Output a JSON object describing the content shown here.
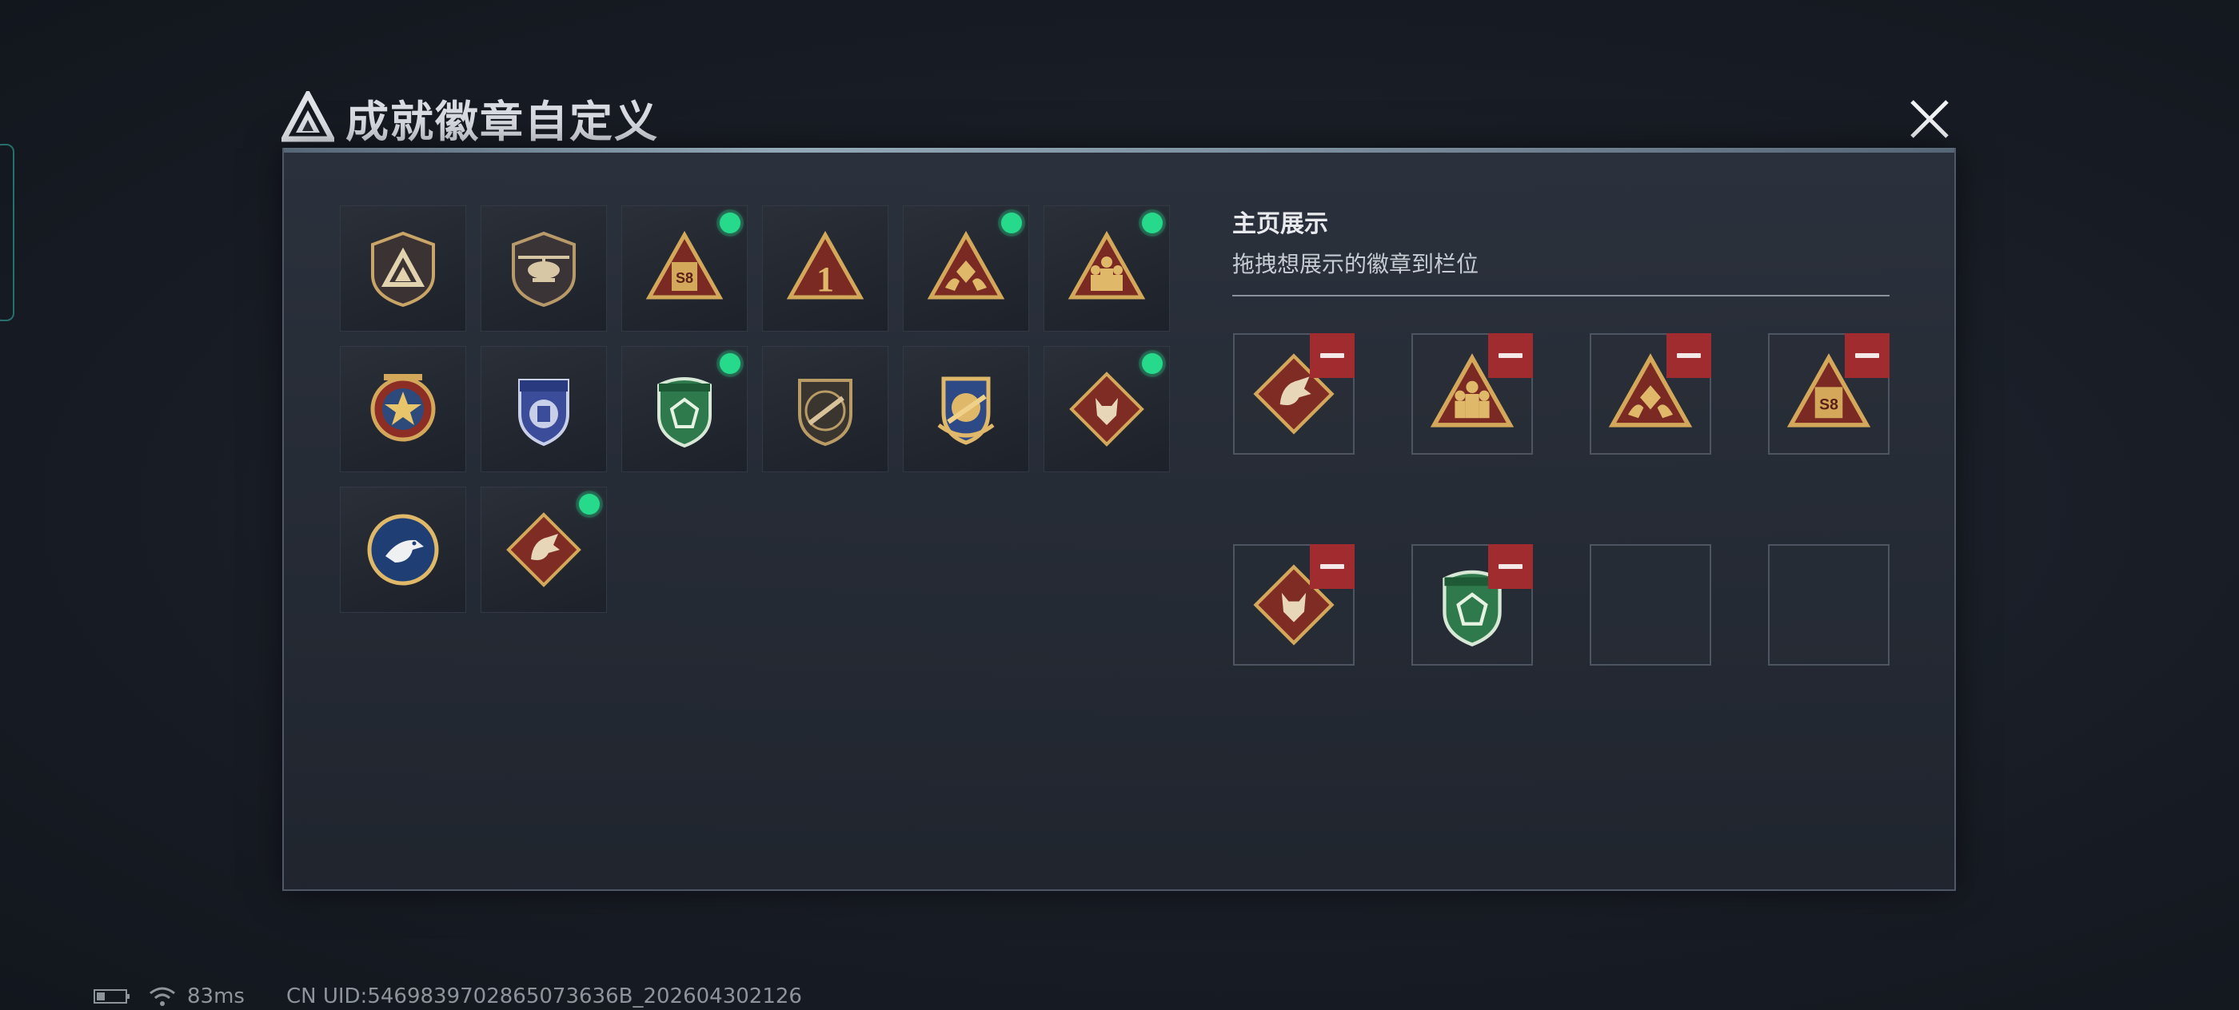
{
  "header": {
    "title": "成就徽章自定义",
    "logo_icon": "triangle-logo-icon",
    "close_icon": "close-icon"
  },
  "badges": [
    {
      "icon": "shield-triangle-badge-icon",
      "selected": false
    },
    {
      "icon": "helicopter-badge-icon",
      "selected": false
    },
    {
      "icon": "s8-triangle-badge-icon",
      "selected": true
    },
    {
      "icon": "number-one-triangle-badge-icon",
      "selected": false
    },
    {
      "icon": "hands-crystal-triangle-badge-icon",
      "selected": true
    },
    {
      "icon": "soldiers-triangle-badge-icon",
      "selected": true
    },
    {
      "icon": "star-medal-badge-icon",
      "selected": false
    },
    {
      "icon": "blue-shield-badge-icon",
      "selected": false
    },
    {
      "icon": "green-crystal-shield-badge-icon",
      "selected": true
    },
    {
      "icon": "rifle-shield-badge-icon",
      "selected": false
    },
    {
      "icon": "blue-gold-crest-badge-icon",
      "selected": false
    },
    {
      "icon": "wolf-diamond-badge-icon",
      "selected": true
    },
    {
      "icon": "eagle-round-badge-icon",
      "selected": false
    },
    {
      "icon": "dragon-diamond-badge-icon",
      "selected": true
    }
  ],
  "showcase": {
    "heading": "主页展示",
    "subtext": "拖拽想展示的徽章到栏位",
    "slots": [
      {
        "icon": "dragon-diamond-badge-icon",
        "filled": true
      },
      {
        "icon": "soldiers-triangle-badge-icon",
        "filled": true
      },
      {
        "icon": "hands-crystal-triangle-badge-icon",
        "filled": true
      },
      {
        "icon": "s8-triangle-badge-icon",
        "filled": true
      },
      {
        "icon": "wolf-diamond-badge-icon",
        "filled": true
      },
      {
        "icon": "green-crystal-shield-badge-icon",
        "filled": true
      },
      {
        "icon": "",
        "filled": false
      },
      {
        "icon": "",
        "filled": false
      }
    ]
  },
  "status_bar": {
    "battery_icon": "battery-icon",
    "wifi_icon": "wifi-icon",
    "ping": "83ms",
    "uid": "CN UID:5469839702865073636B_202604302126"
  },
  "colors": {
    "selected_dot": "#27d98b",
    "remove_button": "#a02c2f",
    "badge_gold": "#d4a85a",
    "badge_red": "#7a2a22"
  }
}
